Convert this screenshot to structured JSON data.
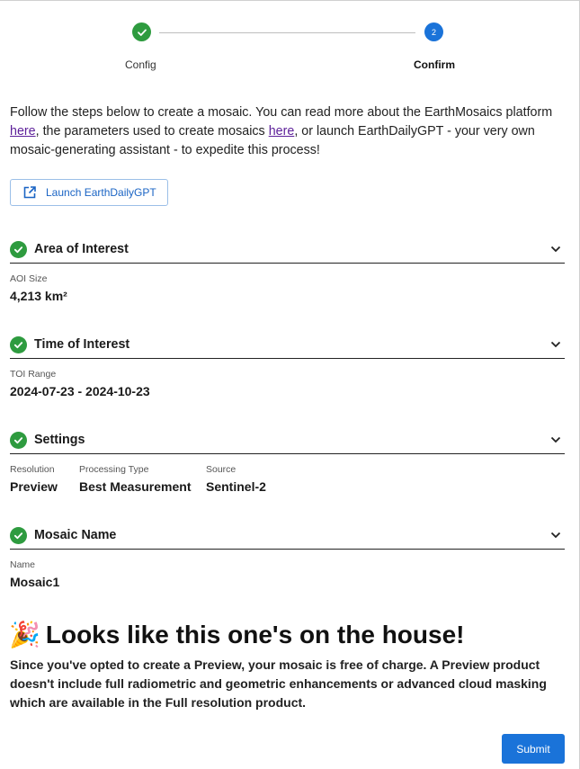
{
  "stepper": {
    "steps": [
      {
        "label": "Config",
        "state": "complete"
      },
      {
        "label": "Confirm",
        "state": "active",
        "number": "2"
      }
    ]
  },
  "intro": {
    "part1": "Follow the steps below to create a mosaic. You can read more about the EarthMosaics platform ",
    "link1": "here",
    "part2": ", the parameters used to create mosaics ",
    "link2": "here",
    "part3": ", or launch EarthDailyGPT - your very own mosaic-generating assistant - to expedite this process!"
  },
  "launch_button": {
    "label": "Launch EarthDailyGPT",
    "icon": "open-external-icon"
  },
  "sections": {
    "aoi": {
      "title": "Area of Interest",
      "field_label": "AOI Size",
      "field_value": "4,213 km²"
    },
    "toi": {
      "title": "Time of Interest",
      "field_label": "TOI Range",
      "field_value": "2024-07-23 - 2024-10-23"
    },
    "settings": {
      "title": "Settings",
      "fields": [
        {
          "label": "Resolution",
          "value": "Preview"
        },
        {
          "label": "Processing Type",
          "value": "Best Measurement"
        },
        {
          "label": "Source",
          "value": "Sentinel-2"
        }
      ]
    },
    "name": {
      "title": "Mosaic Name",
      "field_label": "Name",
      "field_value": "Mosaic1"
    }
  },
  "promo": {
    "emoji": "🎉",
    "title": "Looks like this one's on the house!",
    "body": "Since you've opted to create a Preview, your mosaic is free of charge. A Preview product doesn't include full radiometric and geometric enhancements or advanced cloud masking which are available in the Full resolution product."
  },
  "submit_label": "Submit",
  "colors": {
    "accent": "#1a73d9",
    "success": "#2e9b3f",
    "link": "#5c1f99"
  }
}
